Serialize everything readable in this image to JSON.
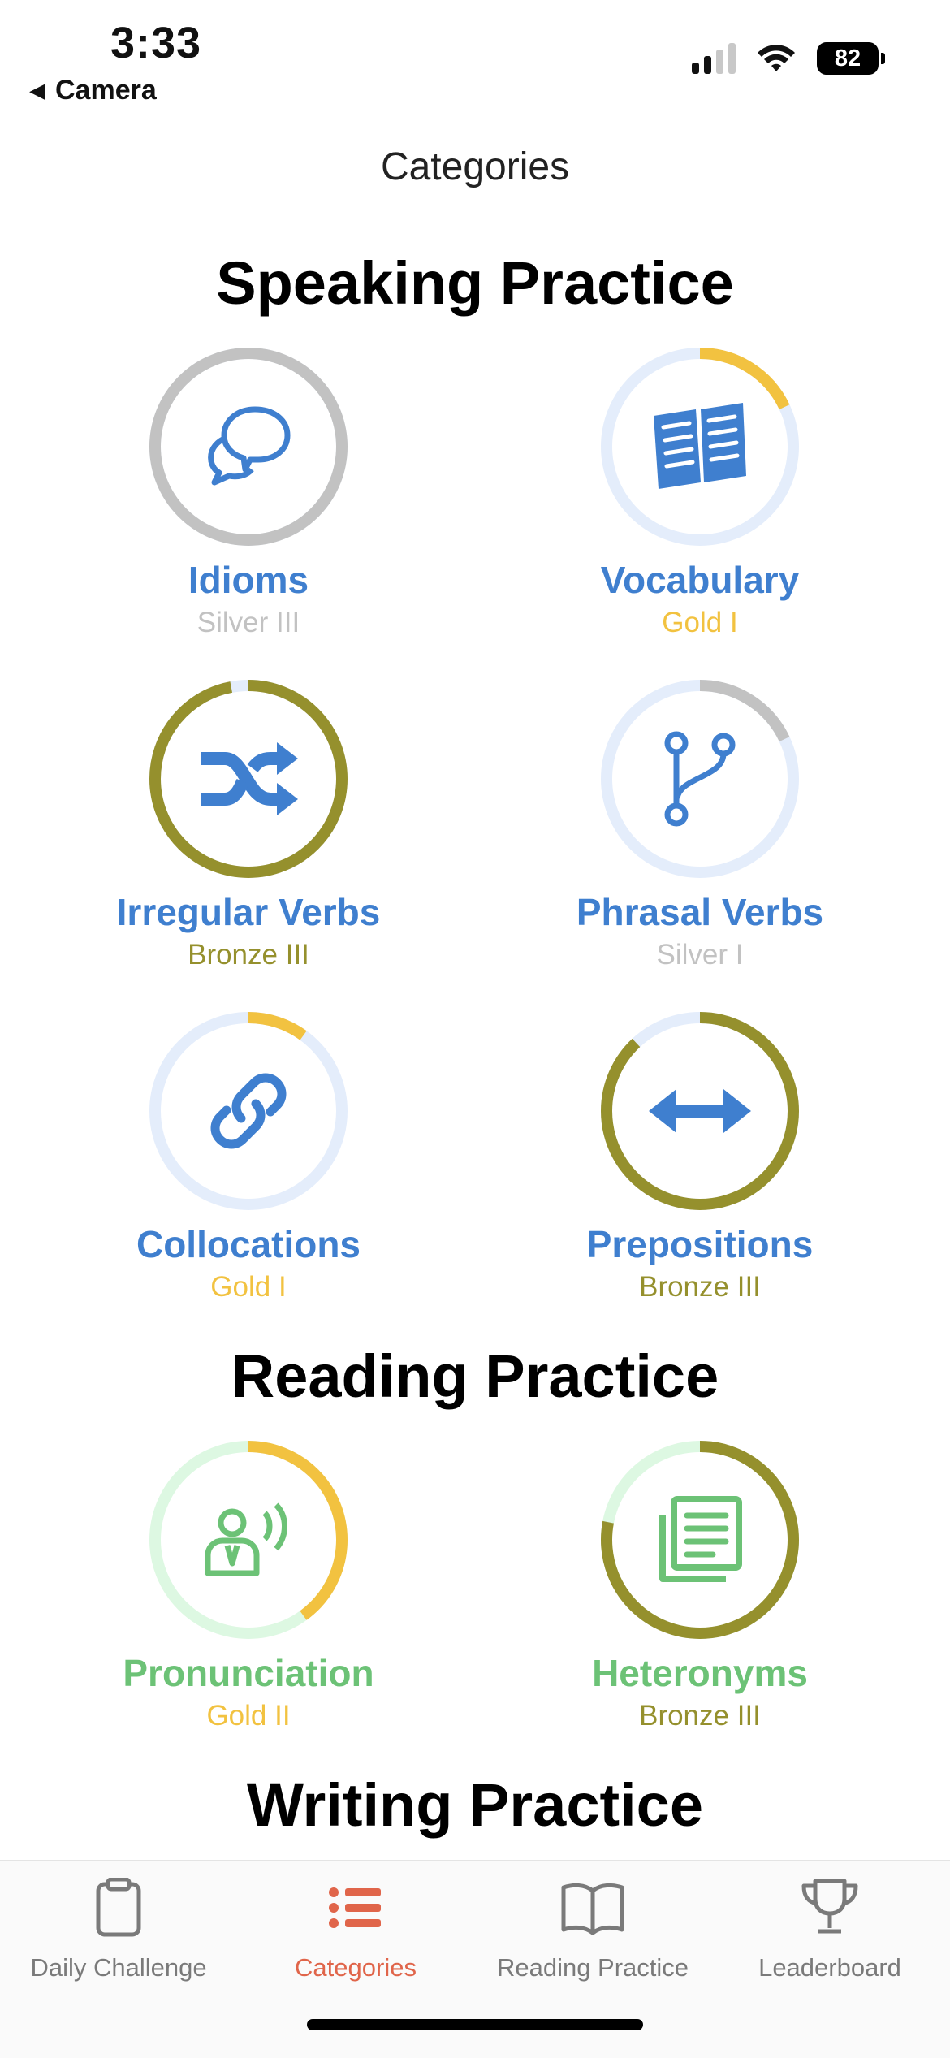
{
  "status": {
    "time": "3:33",
    "back_label": "Camera",
    "battery": "82"
  },
  "nav": {
    "title": "Categories"
  },
  "sections": {
    "speaking": "Speaking Practice",
    "reading": "Reading Practice",
    "writing": "Writing Practice"
  },
  "categories": [
    {
      "label": "Idioms",
      "rank": "Silver III",
      "icon": "chat-bubbles-icon",
      "progress": 1.0,
      "ring_color": "#c2c2c2",
      "label_color": "#3f7fcf",
      "rank_color": "#c2c2c2"
    },
    {
      "label": "Vocabulary",
      "rank": "Gold I",
      "icon": "open-book-icon",
      "progress": 0.18,
      "ring_color": "#f2c240",
      "label_color": "#3f7fcf",
      "rank_color": "#f2c240"
    },
    {
      "label": "Irregular Verbs",
      "rank": "Bronze III",
      "icon": "shuffle-icon",
      "progress": 0.97,
      "ring_color": "#95902d",
      "label_color": "#3f7fcf",
      "rank_color": "#95902d"
    },
    {
      "label": "Phrasal Verbs",
      "rank": "Silver I",
      "icon": "branch-icon",
      "progress": 0.18,
      "ring_color": "#c2c2c2",
      "label_color": "#3f7fcf",
      "rank_color": "#c2c2c2"
    },
    {
      "label": "Collocations",
      "rank": "Gold I",
      "icon": "link-icon",
      "progress": 0.1,
      "ring_color": "#f2c240",
      "label_color": "#3f7fcf",
      "rank_color": "#f2c240"
    },
    {
      "label": "Prepositions",
      "rank": "Bronze III",
      "icon": "double-arrow-icon",
      "progress": 0.88,
      "ring_color": "#95902d",
      "label_color": "#3f7fcf",
      "rank_color": "#95902d"
    },
    {
      "label": "Pronunciation",
      "rank": "Gold II",
      "icon": "speaker-person-icon",
      "progress": 0.4,
      "ring_color": "#f2c240",
      "label_color": "#6cc276",
      "rank_color": "#f2c240"
    },
    {
      "label": "Heteronyms",
      "rank": "Bronze III",
      "icon": "newspaper-icon",
      "progress": 0.78,
      "ring_color": "#95902d",
      "label_color": "#6cc276",
      "rank_color": "#95902d"
    }
  ],
  "tabs": [
    {
      "label": "Daily Challenge",
      "icon": "clipboard-icon",
      "active": false
    },
    {
      "label": "Categories",
      "icon": "list-icon",
      "active": true
    },
    {
      "label": "Reading Practice",
      "icon": "book-icon",
      "active": false
    },
    {
      "label": "Leaderboard",
      "icon": "trophy-icon",
      "active": false
    }
  ],
  "colors": {
    "accent": "#e0654a",
    "blue": "#3f7fcf",
    "green": "#6cc276",
    "blue_track": "#e4edfb",
    "green_track": "#ddf8e2"
  }
}
